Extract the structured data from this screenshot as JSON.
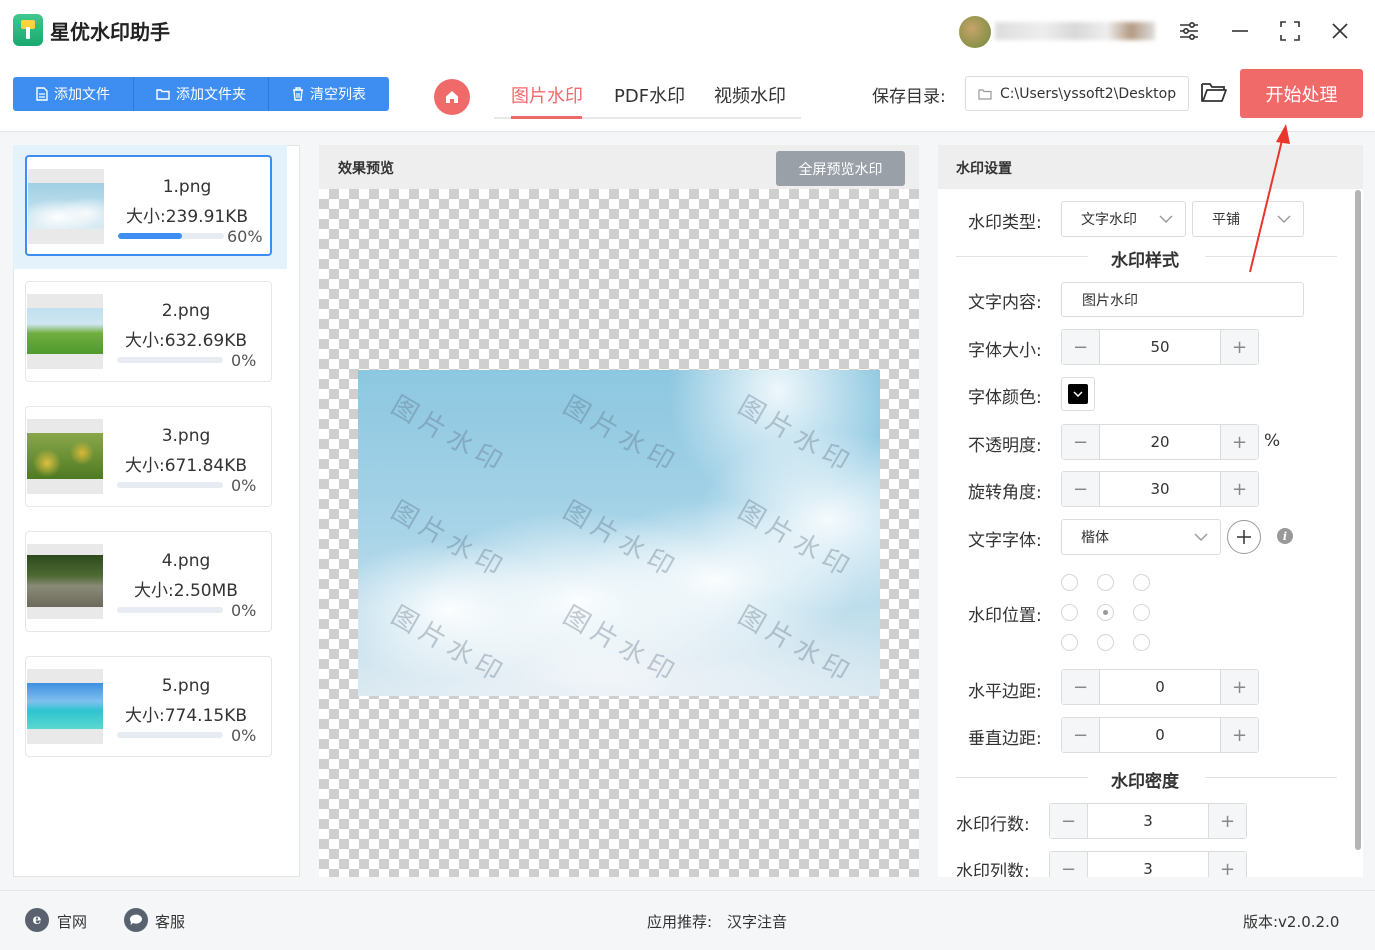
{
  "app": {
    "title": "星优水印助手"
  },
  "window_controls": [
    "settings-sliders-icon",
    "minimize-icon",
    "maximize-icon",
    "close-icon"
  ],
  "toolbar": {
    "add_file": "添加文件",
    "add_folder": "添加文件夹",
    "clear_list": "清空列表",
    "tabs": [
      {
        "label": "图片水印",
        "active": true
      },
      {
        "label": "PDF水印",
        "active": false
      },
      {
        "label": "视频水印",
        "active": false
      }
    ],
    "save_label": "保存目录:",
    "save_path": "C:\\Users\\yssoft2\\Desktop",
    "start": "开始处理"
  },
  "files": [
    {
      "name": "1.png",
      "size": "大小:239.91KB",
      "progress": 60,
      "progress_text": "60%",
      "active": true
    },
    {
      "name": "2.png",
      "size": "大小:632.69KB",
      "progress": 0,
      "progress_text": "0%",
      "active": false
    },
    {
      "name": "3.png",
      "size": "大小:671.84KB",
      "progress": 0,
      "progress_text": "0%",
      "active": false
    },
    {
      "name": "4.png",
      "size": "大小:2.50MB",
      "progress": 0,
      "progress_text": "0%",
      "active": false
    },
    {
      "name": "5.png",
      "size": "大小:774.15KB",
      "progress": 0,
      "progress_text": "0%",
      "active": false
    }
  ],
  "preview": {
    "title": "效果预览",
    "fullscreen": "全屏预览水印",
    "watermark_text": "图片水印"
  },
  "settings": {
    "title": "水印设置",
    "type_label": "水印类型:",
    "type_value": "文字水印",
    "layout_value": "平铺",
    "style_section": "水印样式",
    "text_label": "文字内容:",
    "text_value": "图片水印",
    "size_label": "字体大小:",
    "size_value": "50",
    "color_label": "字体颜色:",
    "color_value": "#000000",
    "opacity_label": "不透明度:",
    "opacity_value": "20",
    "opacity_unit": "%",
    "rotate_label": "旋转角度:",
    "rotate_value": "30",
    "font_label": "文字字体:",
    "font_value": "楷体",
    "position_label": "水印位置:",
    "position_selected": "center",
    "hmargin_label": "水平边距:",
    "hmargin_value": "0",
    "vmargin_label": "垂直边距:",
    "vmargin_value": "0",
    "density_section": "水印密度",
    "rows_label": "水印行数:",
    "rows_value": "3",
    "cols_label": "水印列数:",
    "cols_value": "3"
  },
  "footer": {
    "website": "官网",
    "support": "客服",
    "recommend_label": "应用推荐:",
    "recommend_app": "汉字注音",
    "version": "版本:v2.0.2.0"
  },
  "colors": {
    "primary_blue": "#3d8ef0",
    "accent_red": "#f06a6a"
  }
}
